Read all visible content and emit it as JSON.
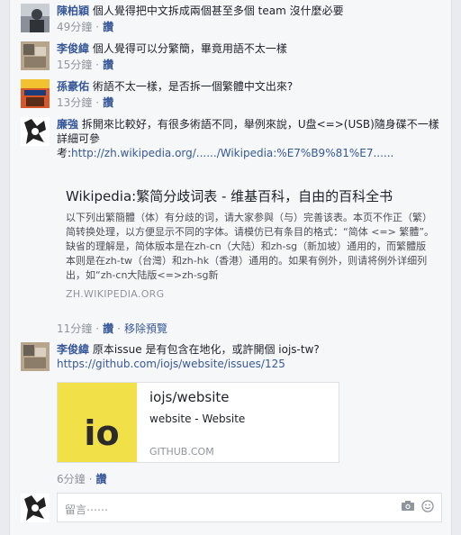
{
  "comments": [
    {
      "author": "陳柏穎",
      "text": "個人覺得把中文拆成兩個甚至多個 team 沒什麼必要",
      "time": "49分鐘",
      "like": "讚"
    },
    {
      "author": "李俊緯",
      "text": "個人覺得可以分繁簡，畢竟用語不太一樣",
      "time": "15分鐘",
      "like": "讚"
    },
    {
      "author": "孫豪佑",
      "text": "術語不太一樣，是否拆一個繁體中文出來?",
      "time": "13分鐘",
      "like": "讚"
    },
    {
      "author": "廉強",
      "text_line1": "拆開來比較好，有很多術語不同，舉例來說，U盘<=>(USB)隨身碟不一樣",
      "text_line2": "詳細可參",
      "text_line3_prefix": "考:",
      "link": "http://zh.wikipedia.org/....../Wikipedia:%E7%B9%81%E7......",
      "preview": {
        "title": "Wikipedia:繁简分歧词表 - 维基百科，自由的百科全书",
        "desc": "以下列出繁簡體（体）有分歧的词，请大家参與（与）完善该表。本页不作正（繁）简转换处理，以方便显示不同的字体。请模仿已有条目的格式：“简体 <=> 繁體”。缺省的理解是，简体版本是在zh-cn（大陆）和zh-sg（新加坡）通用的，而繁體版本则是在zh-tw（台灣）和zh-hk（香港）通用的。如果有例外，则请将例外详细列出，如“zh-cn大陆版<=>zh-sg新",
        "source": "ZH.WIKIPEDIA.ORG"
      },
      "time": "11分鐘",
      "like": "讚",
      "remove_preview": "移除預覽"
    },
    {
      "author": "李俊緯",
      "text": "原本issue 是有包含在地化，或許開個 iojs-tw?",
      "link": "https://github.com/iojs/website/issues/125",
      "card": {
        "thumb_text": "io",
        "title": "iojs/website",
        "subtitle": "website - Website",
        "domain": "GITHUB.COM"
      },
      "time": "6分鐘",
      "like": "讚"
    }
  ],
  "composer": {
    "placeholder": "留言⋯⋯",
    "camera_icon": "camera-icon",
    "emoji_icon": "smiley-icon"
  },
  "colors": {
    "link": "#365899",
    "meta": "#90949c",
    "thumb_bg": "#f2e049"
  }
}
